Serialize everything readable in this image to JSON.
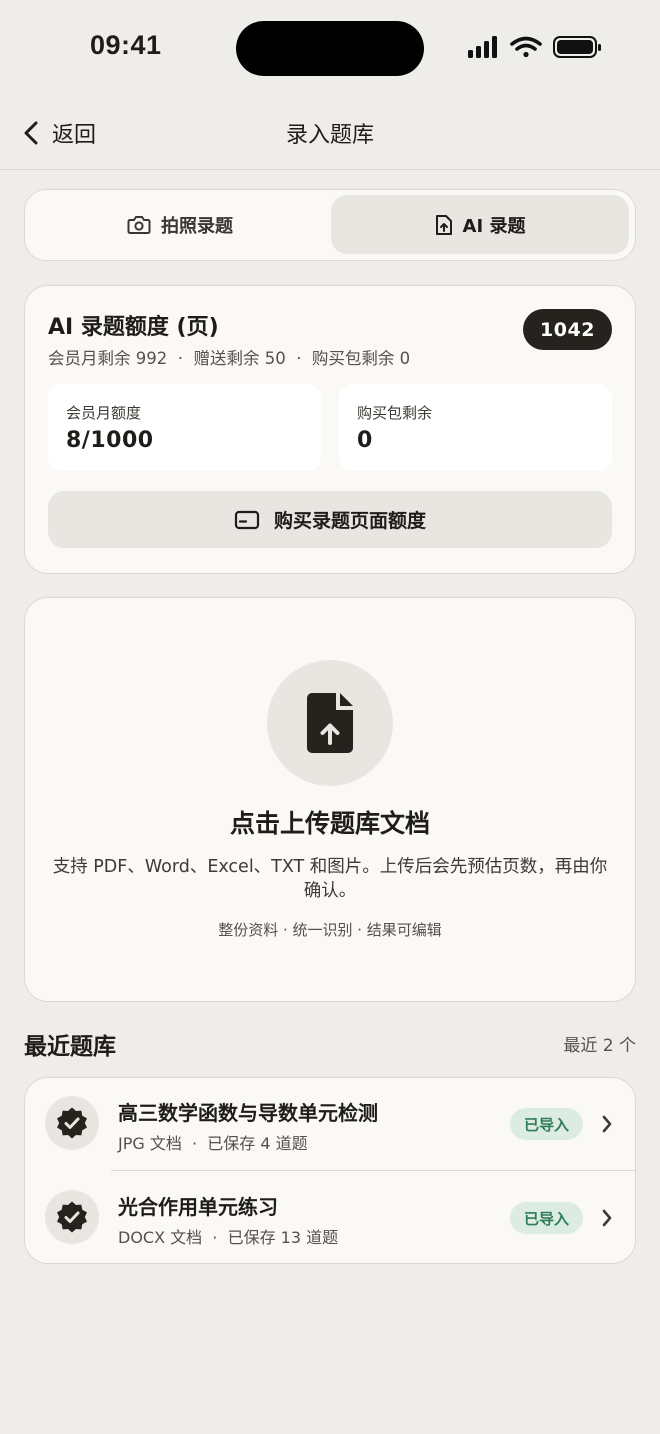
{
  "status": {
    "time": "09:41"
  },
  "nav": {
    "back_label": "返回",
    "title": "录入题库"
  },
  "tabs": [
    {
      "label": "拍照录题",
      "icon": "camera-icon",
      "active": false
    },
    {
      "label": "AI 录题",
      "icon": "file-upload-icon",
      "active": true
    }
  ],
  "quota": {
    "title": "AI 录题额度 (页)",
    "badge": "1042",
    "summary": "会员月剩余 992  ·  赠送剩余 50  ·  购买包剩余 0",
    "stats": [
      {
        "label": "会员月额度",
        "value": "8/1000"
      },
      {
        "label": "购买包剩余",
        "value": "0"
      }
    ],
    "buy_label": "购买录题页面额度"
  },
  "upload": {
    "title": "点击上传题库文档",
    "description": "支持 PDF、Word、Excel、TXT 和图片。上传后会先预估页数，再由你确认。",
    "note": "整份资料 · 统一识别 · 结果可编辑"
  },
  "recent": {
    "title": "最近题库",
    "count": "最近 2 个",
    "items": [
      {
        "title": "高三数学函数与导数单元检测",
        "meta": "JPG 文档  ·  已保存 4 道题",
        "status": "已导入"
      },
      {
        "title": "光合作用单元练习",
        "meta": "DOCX 文档  ·  已保存 13 道题",
        "status": "已导入"
      }
    ]
  },
  "colors": {
    "accent_dark": "#26231f",
    "success_bg": "#dcece3",
    "success_text": "#2e7d57",
    "background": "#efede9"
  }
}
